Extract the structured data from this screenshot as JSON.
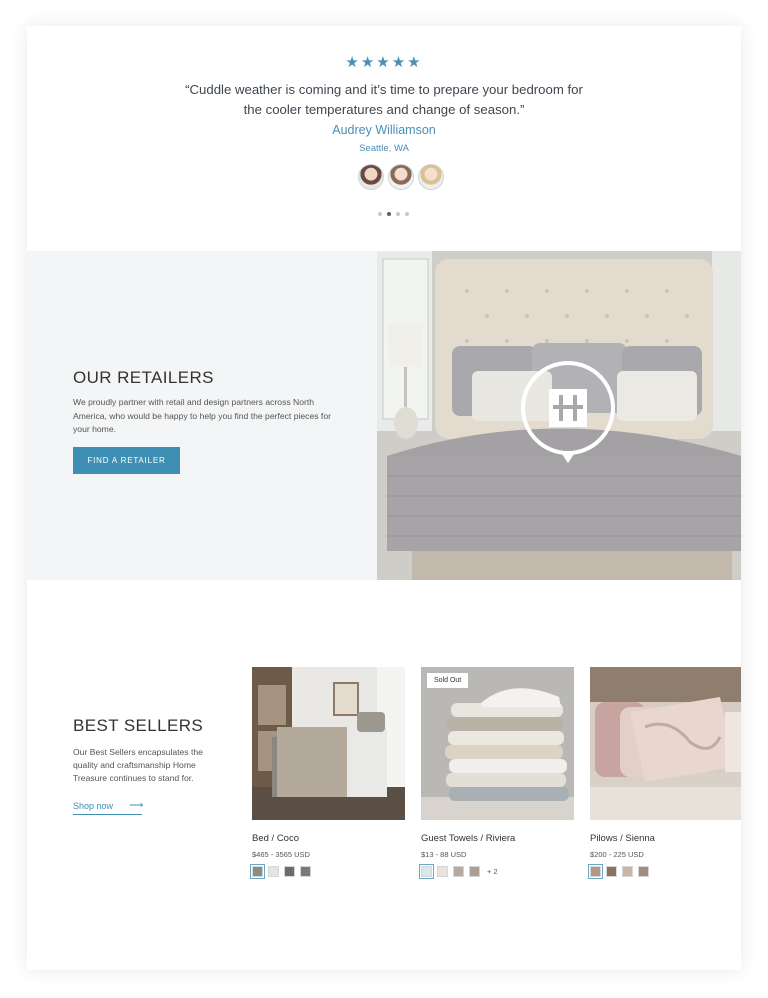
{
  "testimonial": {
    "stars": "★★★★★",
    "quote": "“Cuddle weather is coming and it’s time to prepare your bedroom for the cooler temperatures and change of season.”",
    "author": "Audrey Williamson",
    "location": "Seattle, WA",
    "active_slide": 2,
    "slide_count": 4,
    "accent_color": "#4a8fb5"
  },
  "retailers": {
    "title": "OUR RETAILERS",
    "text": "We proudly partner with retail and design partners across North America, who would be happy to help you find the perfect pieces for your home.",
    "button_label": "FIND A RETAILER",
    "button_color": "#3f8eb3"
  },
  "best_sellers": {
    "title": "BEST SELLERS",
    "text": "Our Best Sellers encapsulates the quality and craftsmanship Home Treasure continues to stand for.",
    "link_label": "Shop now",
    "products": [
      {
        "name": "Bed / Coco",
        "price": "$465 - 3565 USD",
        "badge": "",
        "swatches": [
          "#8e8a84",
          "#e4e4e6",
          "#6f6a66",
          "#7a7878"
        ],
        "more": ""
      },
      {
        "name": "Guest Towels / Riviera",
        "price": "$13 - 88 USD",
        "badge": "Sold Out",
        "swatches": [
          "#d9e7ec",
          "#e8e3dd",
          "#b4aca3",
          "#ab9f93"
        ],
        "more": "+ 2"
      },
      {
        "name": "Pilows / Sienna",
        "price": "$200 - 225 USD",
        "badge": "",
        "swatches": [
          "#b59783",
          "#8a7260",
          "#c9b6a6",
          "#a18d80"
        ],
        "more": ""
      }
    ]
  }
}
